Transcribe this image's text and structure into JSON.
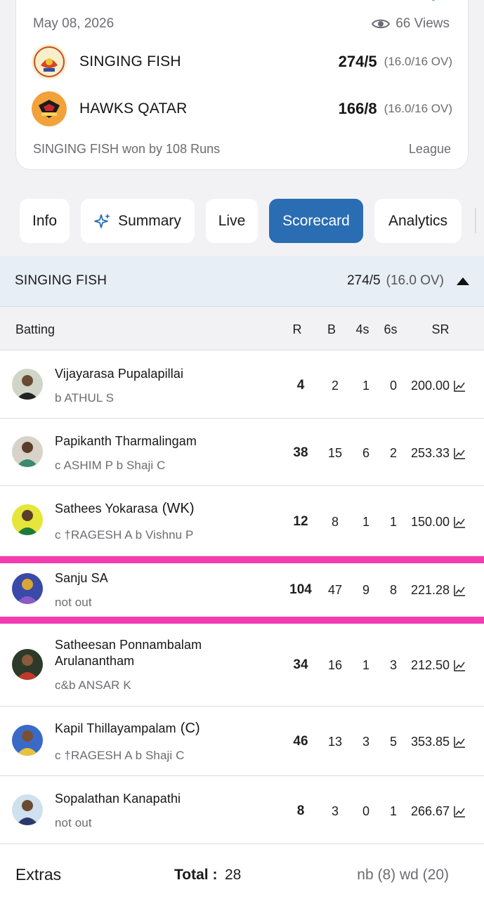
{
  "match": {
    "date": "May 08, 2026",
    "views": "66 Views",
    "teams": [
      {
        "name": "SINGING FISH",
        "score": "274/5",
        "overs": "(16.0/16 OV)"
      },
      {
        "name": "HAWKS QATAR",
        "score": "166/8",
        "overs": "(16.0/16 OV)"
      }
    ],
    "result": "SINGING FISH won by 108 Runs",
    "type": "League"
  },
  "tabs": [
    "Info",
    "Summary",
    "Live",
    "Scorecard",
    "Analytics"
  ],
  "active_tab": "Scorecard",
  "innings": {
    "team": "SINGING FISH",
    "score": "274/5",
    "overs": "(16.0 OV)"
  },
  "columns": {
    "batting": "Batting",
    "runs": "R",
    "balls": "B",
    "fours": "4s",
    "sixes": "6s",
    "sr": "SR"
  },
  "batters": [
    {
      "name": "Vijayarasa Pupalapillai",
      "tag": "",
      "dismissal": "b ATHUL S",
      "runs": "4",
      "balls": "2",
      "fours": "1",
      "sixes": "0",
      "sr": "200.00"
    },
    {
      "name": "Papikanth Tharmalingam",
      "tag": "",
      "dismissal": "c ASHIM P b Shaji C",
      "runs": "38",
      "balls": "15",
      "fours": "6",
      "sixes": "2",
      "sr": "253.33"
    },
    {
      "name": "Sathees Yokarasa",
      "tag": "(WK)",
      "dismissal": "c †RAGESH A b Vishnu P",
      "runs": "12",
      "balls": "8",
      "fours": "1",
      "sixes": "1",
      "sr": "150.00"
    },
    {
      "name": "Sanju SA",
      "tag": "",
      "dismissal": "not out",
      "runs": "104",
      "balls": "47",
      "fours": "9",
      "sixes": "8",
      "sr": "221.28"
    },
    {
      "name": "Satheesan Ponnambalam Arulanantham",
      "tag": "",
      "dismissal": "c&b ANSAR K",
      "runs": "34",
      "balls": "16",
      "fours": "1",
      "sixes": "3",
      "sr": "212.50"
    },
    {
      "name": "Kapil Thillayampalam",
      "tag": "(C)",
      "dismissal": "c †RAGESH A b Shaji C",
      "runs": "46",
      "balls": "13",
      "fours": "3",
      "sixes": "5",
      "sr": "353.85"
    },
    {
      "name": "Sopalathan Kanapathi",
      "tag": "",
      "dismissal": "not out",
      "runs": "8",
      "balls": "3",
      "fours": "0",
      "sixes": "1",
      "sr": "266.67"
    }
  ],
  "extras": {
    "label": "Extras",
    "total_label": "Total :",
    "total": "28",
    "breakdown": "nb (8) wd (20)"
  },
  "colors": {
    "accent": "#2a6db3",
    "highlight": "#f23cb0",
    "innings_bg": "#e8eef6"
  }
}
